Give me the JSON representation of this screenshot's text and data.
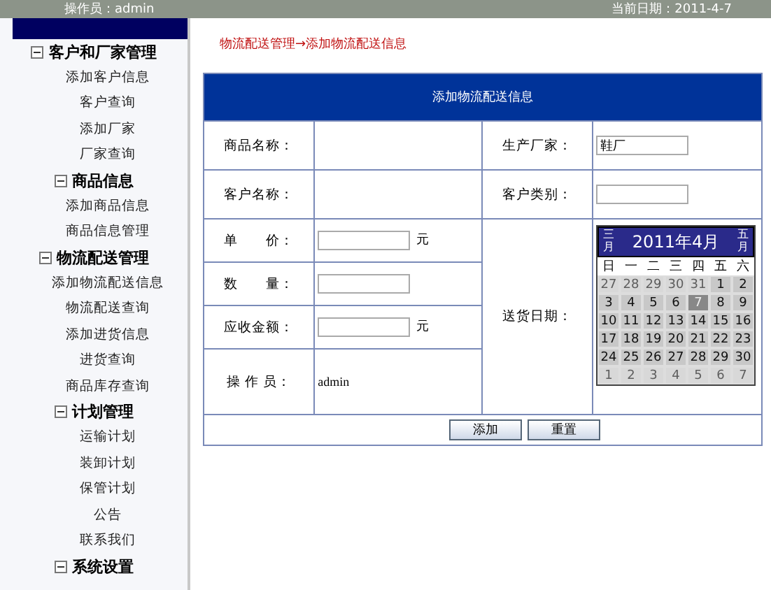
{
  "top_bar": {
    "operator": "操作员：admin",
    "date": "当前日期：2011-4-7"
  },
  "sidebar": {
    "groups": [
      {
        "title": "客户和厂家管理",
        "expanded": true,
        "items": [
          "添加客户信息",
          "客户查询",
          "添加厂家",
          "厂家查询"
        ]
      },
      {
        "title": "商品信息",
        "expanded": true,
        "items": [
          "添加商品信息",
          "商品信息管理"
        ]
      },
      {
        "title": "物流配送管理",
        "expanded": true,
        "items": [
          "添加物流配送信息",
          "物流配送查询",
          "添加进货信息",
          "进货查询",
          "商品库存查询"
        ]
      },
      {
        "title": "计划管理",
        "expanded": true,
        "items": [
          "运输计划",
          "装卸计划",
          "保管计划",
          "公告",
          "联系我们"
        ]
      },
      {
        "title": "系统设置",
        "expanded": true
      }
    ]
  },
  "breadcrumb": "物流配送管理→添加物流配送信息",
  "form": {
    "title": "添加物流配送信息",
    "fields": [
      {
        "kind": "blank",
        "label": "商品名称："
      },
      {
        "kind": "input",
        "label": "生产厂家：",
        "value": "鞋厂"
      },
      {
        "kind": "blank",
        "label": "客户名称："
      },
      {
        "kind": "input",
        "label": "客户类别："
      },
      {
        "kind": "input",
        "label": "单　　价：",
        "unit": "元"
      },
      {
        "kind": "input",
        "label": "数　　量："
      },
      {
        "kind": "input",
        "label": "应收金额：",
        "unit": "元"
      },
      {
        "kind": "text",
        "label": "操 作 员：",
        "value": "admin"
      }
    ],
    "date_label": "送货日期：",
    "calendar": {
      "prev": "三月",
      "title": "2011年4月",
      "next": "五月",
      "weekdays": [
        "日",
        "一",
        "二",
        "三",
        "四",
        "五",
        "六"
      ],
      "days": [
        {
          "day": "27",
          "other": true,
          "selected": false
        },
        {
          "day": "28",
          "other": true,
          "selected": false
        },
        {
          "day": "29",
          "other": true,
          "selected": false
        },
        {
          "day": "30",
          "other": true,
          "selected": false
        },
        {
          "day": "31",
          "other": true,
          "selected": false
        },
        {
          "day": "1",
          "other": false,
          "selected": false
        },
        {
          "day": "2",
          "other": false,
          "selected": false
        },
        {
          "day": "3",
          "other": false,
          "selected": false
        },
        {
          "day": "4",
          "other": false,
          "selected": false
        },
        {
          "day": "5",
          "other": false,
          "selected": false
        },
        {
          "day": "6",
          "other": false,
          "selected": false
        },
        {
          "day": "7",
          "other": false,
          "selected": true
        },
        {
          "day": "8",
          "other": false,
          "selected": false
        },
        {
          "day": "9",
          "other": false,
          "selected": false
        },
        {
          "day": "10",
          "other": false,
          "selected": false
        },
        {
          "day": "11",
          "other": false,
          "selected": false
        },
        {
          "day": "12",
          "other": false,
          "selected": false
        },
        {
          "day": "13",
          "other": false,
          "selected": false
        },
        {
          "day": "14",
          "other": false,
          "selected": false
        },
        {
          "day": "15",
          "other": false,
          "selected": false
        },
        {
          "day": "16",
          "other": false,
          "selected": false
        },
        {
          "day": "17",
          "other": false,
          "selected": false
        },
        {
          "day": "18",
          "other": false,
          "selected": false
        },
        {
          "day": "19",
          "other": false,
          "selected": false
        },
        {
          "day": "20",
          "other": false,
          "selected": false
        },
        {
          "day": "21",
          "other": false,
          "selected": false
        },
        {
          "day": "22",
          "other": false,
          "selected": false
        },
        {
          "day": "23",
          "other": false,
          "selected": false
        },
        {
          "day": "24",
          "other": false,
          "selected": false
        },
        {
          "day": "25",
          "other": false,
          "selected": false
        },
        {
          "day": "26",
          "other": false,
          "selected": false
        },
        {
          "day": "27",
          "other": false,
          "selected": false
        },
        {
          "day": "28",
          "other": false,
          "selected": false
        },
        {
          "day": "29",
          "other": false,
          "selected": false
        },
        {
          "day": "30",
          "other": false,
          "selected": false
        },
        {
          "day": "1",
          "other": true,
          "selected": false
        },
        {
          "day": "2",
          "other": true,
          "selected": false
        },
        {
          "day": "3",
          "other": true,
          "selected": false
        },
        {
          "day": "4",
          "other": true,
          "selected": false
        },
        {
          "day": "5",
          "other": true,
          "selected": false
        },
        {
          "day": "6",
          "other": true,
          "selected": false
        },
        {
          "day": "7",
          "other": true,
          "selected": false
        }
      ]
    },
    "buttons": [
      "添加",
      "重置"
    ]
  }
}
